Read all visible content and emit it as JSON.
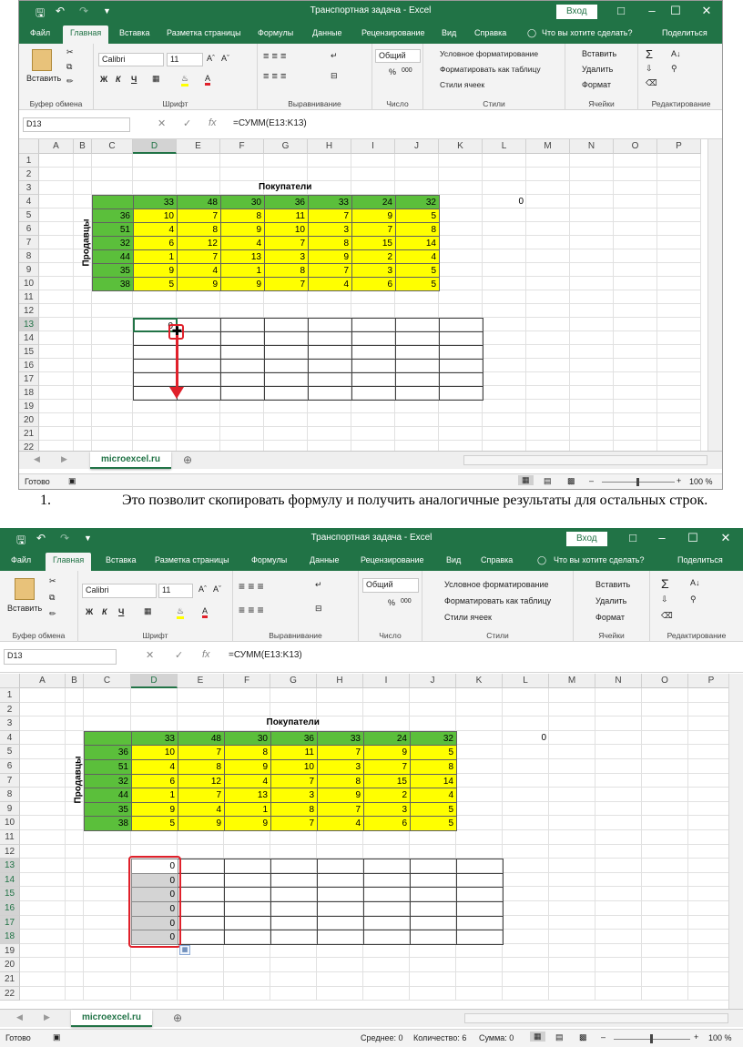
{
  "window": {
    "title": "Транспортная задача - Excel",
    "enter_label": "Вход"
  },
  "tabs": [
    "Файл",
    "Главная",
    "Вставка",
    "Разметка страницы",
    "Формулы",
    "Данные",
    "Рецензирование",
    "Вид",
    "Справка"
  ],
  "tell_me": "Что вы хотите сделать?",
  "share": "Поделиться",
  "ribbon": {
    "clipboard": {
      "paste": "Вставить",
      "group": "Буфер обмена"
    },
    "font": {
      "name": "Calibri",
      "size": "11",
      "bold": "Ж",
      "italic": "К",
      "underline": "Ч",
      "group": "Шрифт"
    },
    "alignment": {
      "group": "Выравнивание"
    },
    "number": {
      "format": "Общий",
      "percent": "%",
      "thousands": "000",
      "group": "Число"
    },
    "styles": {
      "cond": "Условное форматирование",
      "table": "Форматировать как таблицу",
      "cell": "Стили ячеек",
      "group": "Стили"
    },
    "cells": {
      "insert": "Вставить",
      "delete": "Удалить",
      "format": "Формат",
      "group": "Ячейки"
    },
    "editing": {
      "group": "Редактирование"
    }
  },
  "formula_bar": {
    "name_box": "D13",
    "fx": "fx",
    "formula": "=СУММ(E13:K13)"
  },
  "columns": [
    "A",
    "B",
    "C",
    "D",
    "E",
    "F",
    "G",
    "H",
    "I",
    "J",
    "K",
    "L",
    "M",
    "N",
    "O",
    "P"
  ],
  "rows": [
    "1",
    "2",
    "3",
    "4",
    "5",
    "6",
    "7",
    "8",
    "9",
    "10",
    "11",
    "12",
    "13",
    "14",
    "15",
    "16",
    "17",
    "18",
    "19",
    "20",
    "21",
    "22"
  ],
  "sheet": {
    "buyers_label": "Покупатели",
    "sellers_label": "Продавцы",
    "header_row": [
      "33",
      "48",
      "30",
      "36",
      "33",
      "24",
      "32"
    ],
    "sellers": [
      "36",
      "51",
      "32",
      "44",
      "35",
      "38"
    ],
    "matrix": [
      [
        "10",
        "7",
        "8",
        "11",
        "7",
        "9",
        "5"
      ],
      [
        "4",
        "8",
        "9",
        "10",
        "3",
        "7",
        "8"
      ],
      [
        "6",
        "12",
        "4",
        "7",
        "8",
        "15",
        "14"
      ],
      [
        "1",
        "7",
        "13",
        "3",
        "9",
        "2",
        "4"
      ],
      [
        "9",
        "4",
        "1",
        "8",
        "7",
        "3",
        "5"
      ],
      [
        "5",
        "9",
        "9",
        "7",
        "4",
        "6",
        "5"
      ]
    ],
    "l4_value": "0",
    "d13_value": "0",
    "filled_values": [
      "0",
      "0",
      "0",
      "0",
      "0",
      "0"
    ]
  },
  "sheet_tab": "microexcel.ru",
  "status": {
    "ready": "Готово",
    "zoom": "100 %",
    "average": "Среднее: 0",
    "count": "Количество: 6",
    "sum": "Сумма: 0"
  },
  "caption": {
    "number": "1.",
    "text": "Это позволит скопировать формулу и получить аналогичные результаты для остальных строк."
  },
  "colors": {
    "excel_green": "#217346",
    "cell_green": "#5bbf3b",
    "cell_yellow": "#ffff00",
    "highlight_red": "#e0202a"
  }
}
